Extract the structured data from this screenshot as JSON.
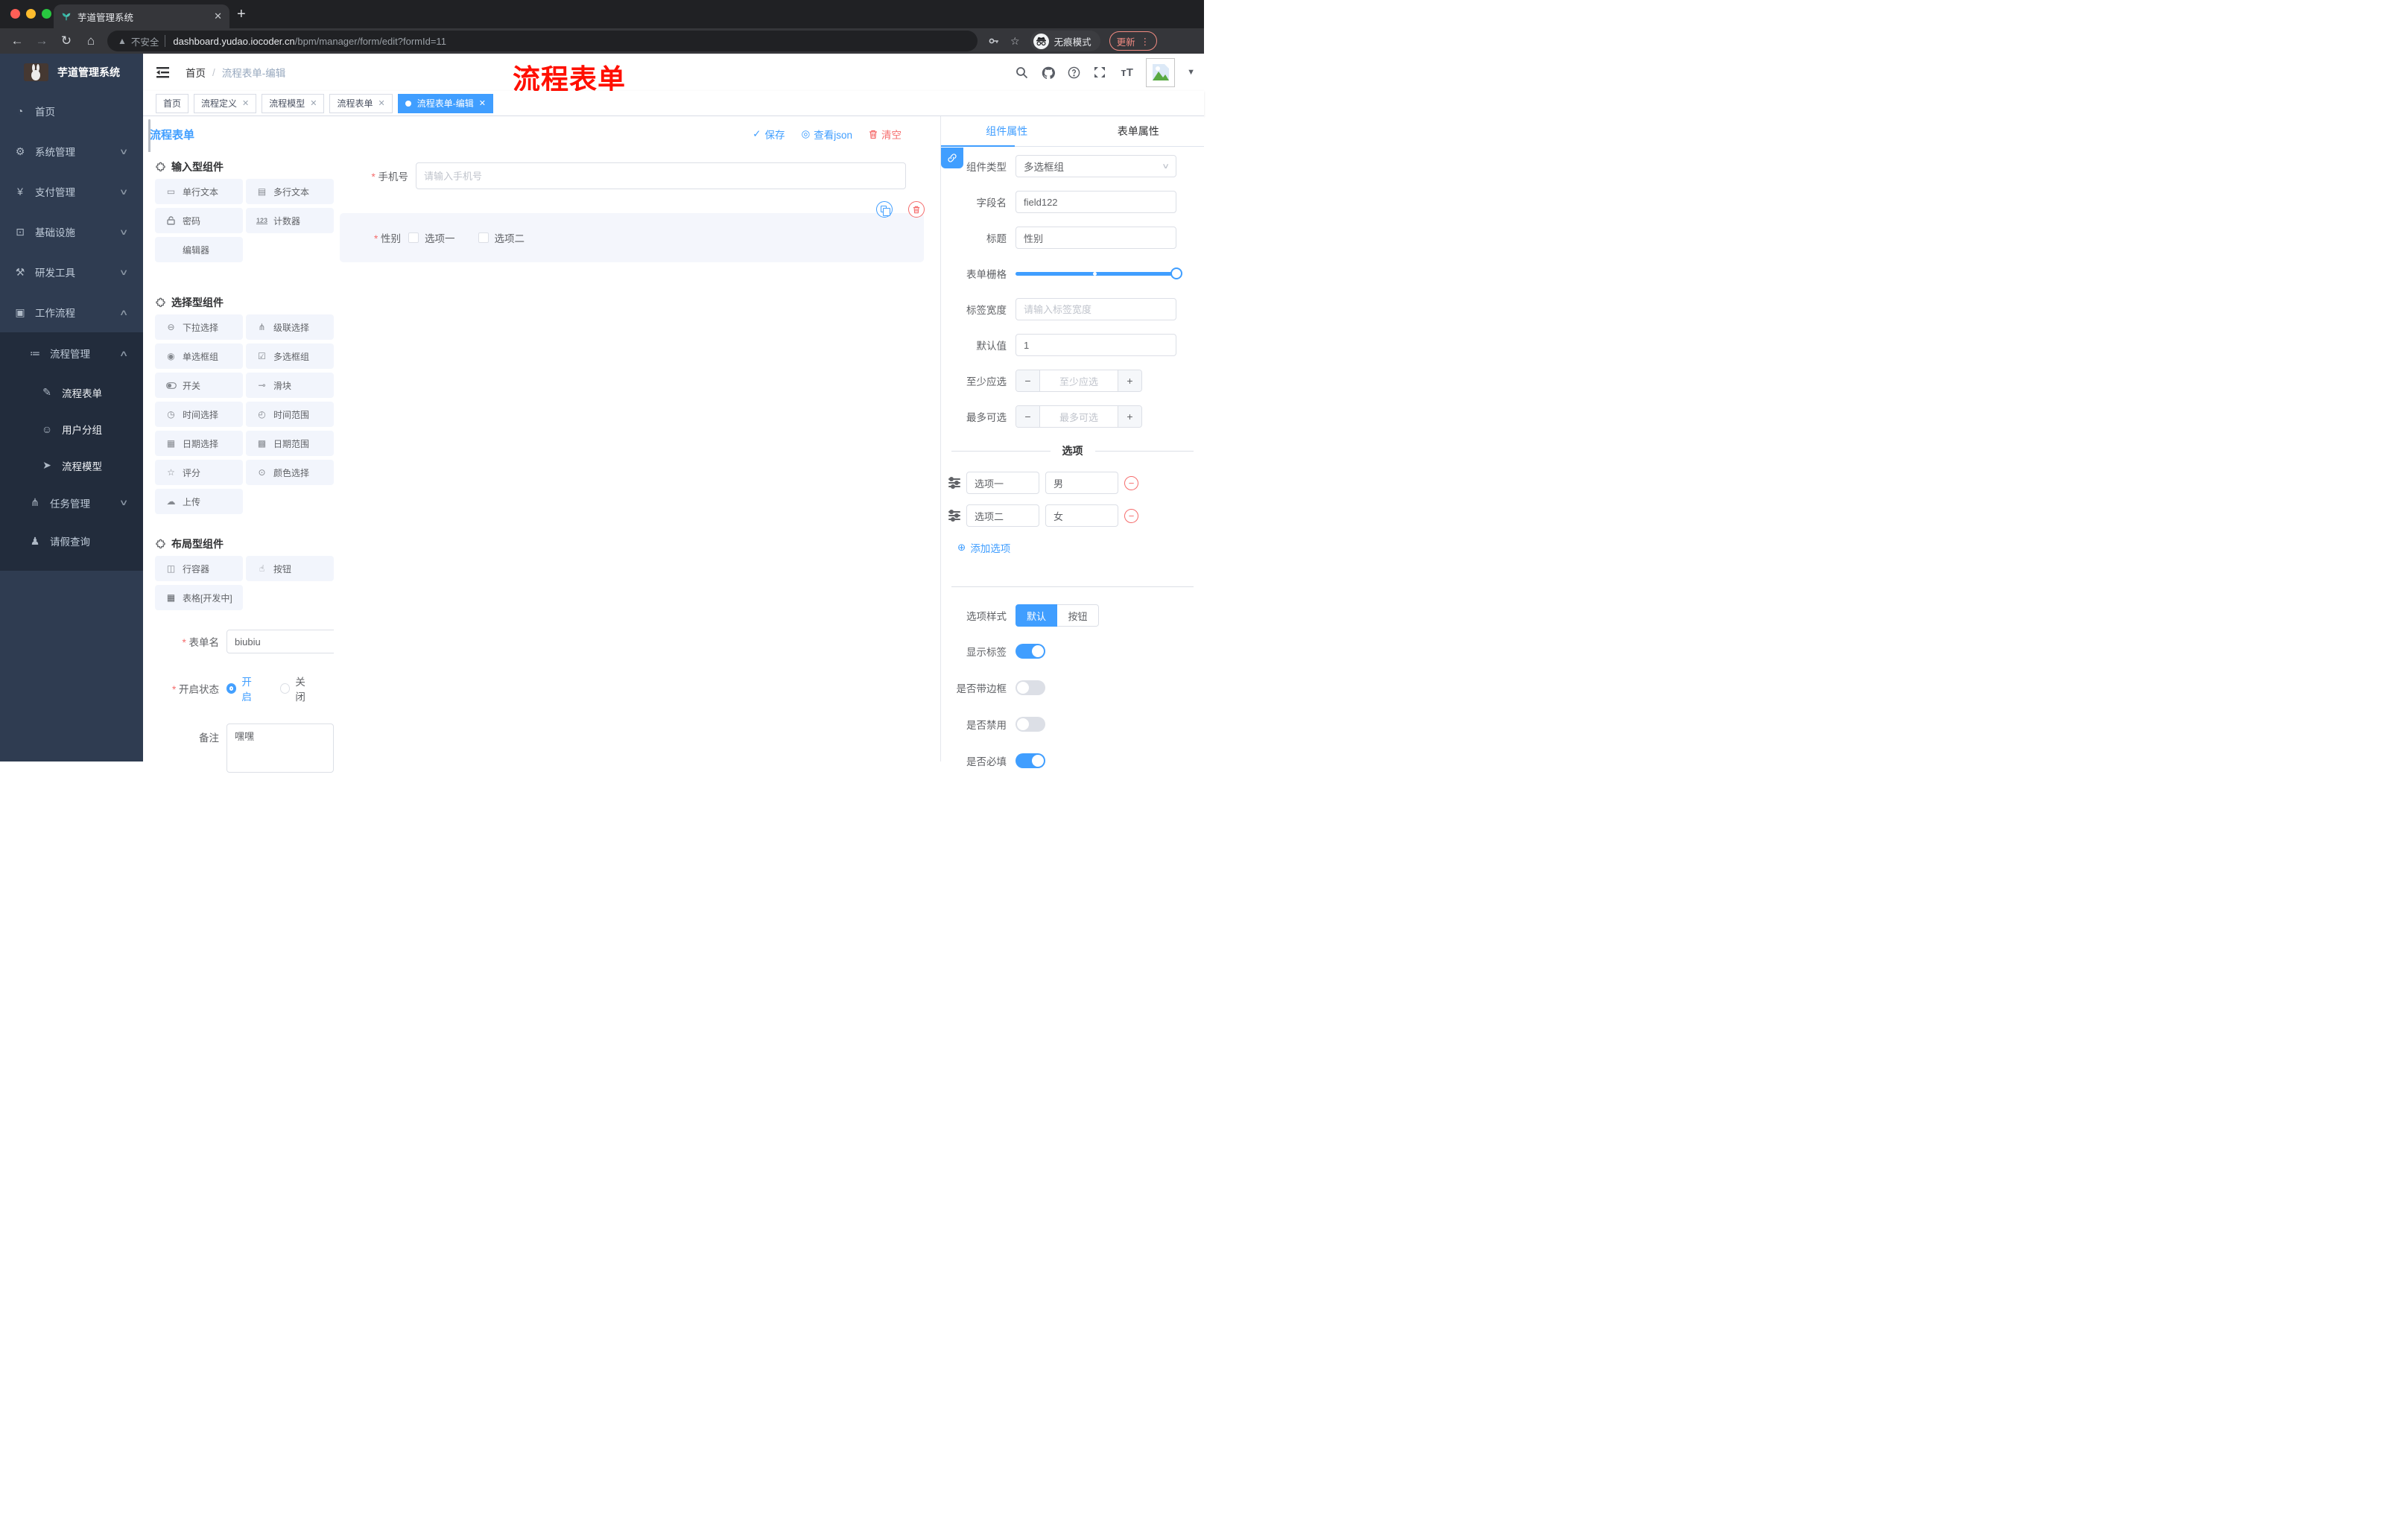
{
  "colors": {
    "accent": "#409eff",
    "danger": "#f56c6c",
    "annotation": "#ff0f00",
    "sidebar_bg": "#2f3c51",
    "tab_active": "#409eff"
  },
  "browser": {
    "tab_title": "芋道管理系统",
    "url": {
      "not_secure": "不安全",
      "domain": "dashboard.yudao.iocoder.cn",
      "path": "/bpm/manager/form/edit?formId=11"
    },
    "incognito_label": "无痕模式",
    "update_label": "更新"
  },
  "sidebar": {
    "brand": "芋道管理系统",
    "items": [
      "首页",
      "系统管理",
      "支付管理",
      "基础设施",
      "研发工具",
      "工作流程",
      "流程管理",
      "流程表单",
      "用户分组",
      "流程模型",
      "任务管理",
      "请假查询"
    ]
  },
  "header": {
    "breadcrumb": {
      "home": "首页",
      "current": "流程表单-编辑"
    },
    "annotation": "流程表单"
  },
  "tags": [
    "首页",
    "流程定义",
    "流程模型",
    "流程表单",
    "流程表单-编辑"
  ],
  "designer": {
    "title": "流程表单",
    "actions": {
      "save": "保存",
      "view_json": "查看json",
      "clear": "清空"
    }
  },
  "palette": {
    "sections": [
      {
        "title": "输入型组件",
        "items": [
          "单行文本",
          "多行文本",
          "密码",
          "计数器",
          "编辑器"
        ]
      },
      {
        "title": "选择型组件",
        "items": [
          "下拉选择",
          "级联选择",
          "单选框组",
          "多选框组",
          "开关",
          "滑块",
          "时间选择",
          "时间范围",
          "日期选择",
          "日期范围",
          "评分",
          "颜色选择",
          "上传"
        ]
      },
      {
        "title": "布局型组件",
        "items": [
          "行容器",
          "按钮",
          "表格[开发中]"
        ]
      }
    ]
  },
  "meta_form": {
    "name_label": "表单名",
    "name_value": "biubiu",
    "status_label": "开启状态",
    "status_on": "开启",
    "status_off": "关闭",
    "remark_label": "备注",
    "remark_value": "嘿嘿"
  },
  "canvas": {
    "phone": {
      "label": "手机号",
      "placeholder": "请输入手机号"
    },
    "gender": {
      "label": "性别",
      "option1": "选项一",
      "option2": "选项二"
    }
  },
  "props": {
    "tab_component": "组件属性",
    "tab_form": "表单属性",
    "type_label": "组件类型",
    "type_value": "多选框组",
    "field_label": "字段名",
    "field_value": "field122",
    "title_label": "标题",
    "title_value": "性别",
    "grid_label": "表单栅格",
    "labelw_label": "标签宽度",
    "labelw_placeholder": "请输入标签宽度",
    "default_label": "默认值",
    "default_value": "1",
    "min_label": "至少应选",
    "min_placeholder": "至少应选",
    "max_label": "最多可选",
    "max_placeholder": "最多可选",
    "options_title": "选项",
    "options": [
      {
        "label": "选项一",
        "value": "男"
      },
      {
        "label": "选项二",
        "value": "女"
      }
    ],
    "add_option": "添加选项",
    "style_label": "选项样式",
    "style_default": "默认",
    "style_button": "按钮",
    "switches": {
      "show_label": "显示标签",
      "border": "是否带边框",
      "disabled": "是否禁用",
      "required": "是否必填"
    }
  }
}
